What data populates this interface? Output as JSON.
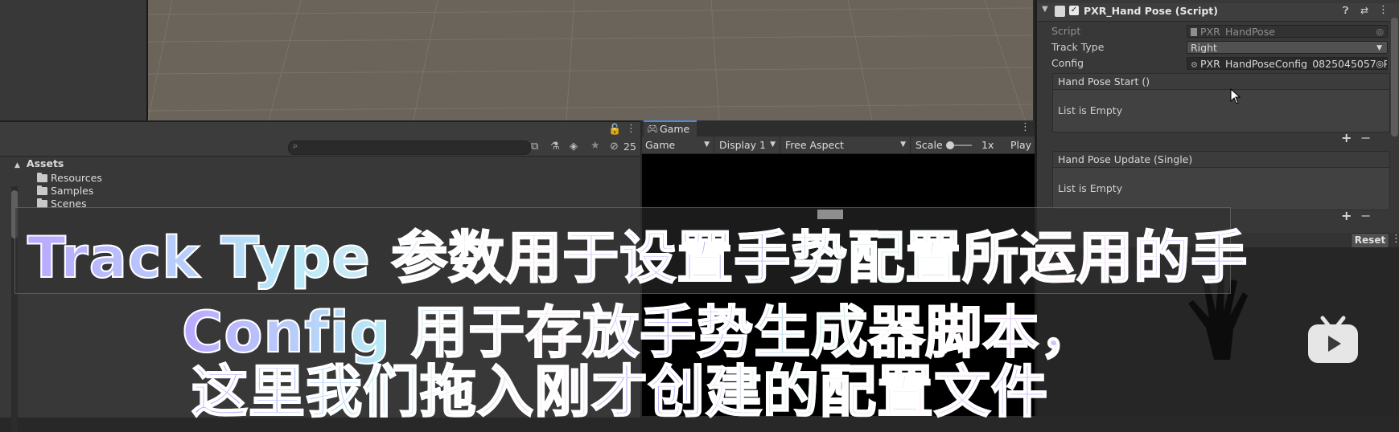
{
  "project": {
    "result_count": "25",
    "assets_header": "Assets",
    "folders": [
      "Resources",
      "Samples",
      "Scenes"
    ]
  },
  "game": {
    "tab_label": "Game",
    "view_select": "Game",
    "display_select": "Display 1",
    "aspect_select": "Free Aspect",
    "scale_label": "Scale",
    "scale_value": "1x",
    "play_label": "Play"
  },
  "inspector": {
    "component_title": "PXR_Hand Pose (Script)",
    "script_label": "Script",
    "script_value": "PXR_HandPose",
    "track_type_label": "Track Type",
    "track_type_value": "Right",
    "config_label": "Config",
    "config_value": "PXR_HandPoseConfig_0825045057 (P",
    "event_start_title": "Hand Pose Start ()",
    "event_start_empty": "List is Empty",
    "event_update_title": "Hand Pose Update (Single)",
    "event_update_empty": "List is Empty",
    "reset_label": "Reset"
  },
  "captions": {
    "line1": "Track Type 参数用于设置手势配置所运用的手",
    "line2": "Config 用于存放手势生成器脚本，",
    "line3": "这里我们拖入刚才创建的配置文件"
  },
  "colors": {
    "accent_tab": "#4a8ae0",
    "scene_bg": "#6b645b",
    "panel_bg": "#383838"
  }
}
